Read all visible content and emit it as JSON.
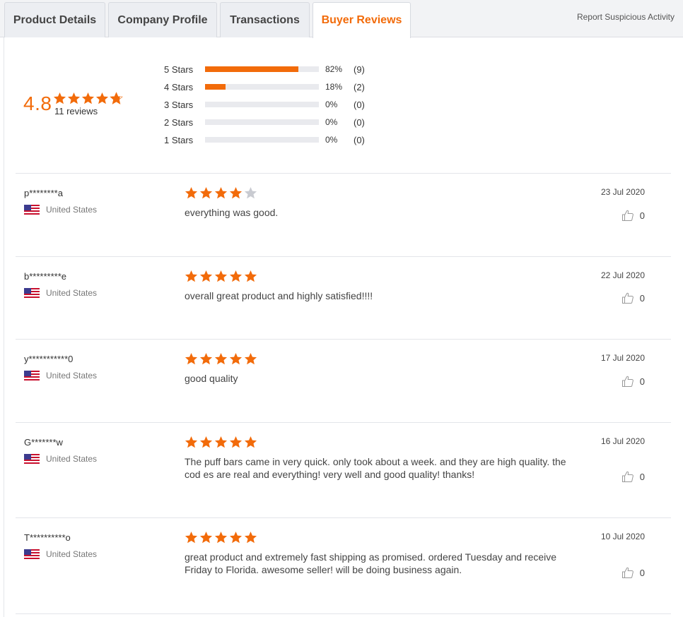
{
  "tabs": [
    {
      "label": "Product Details"
    },
    {
      "label": "Company Profile"
    },
    {
      "label": "Transactions"
    },
    {
      "label": "Buyer Reviews",
      "active": true
    }
  ],
  "report_link": "Report Suspicious Activity",
  "summary": {
    "score": "4.8",
    "stars_filled": 4.8,
    "reviews_label": "11 reviews"
  },
  "distribution": [
    {
      "label": "5 Stars",
      "percent_text": "82%",
      "percent": 82,
      "count": "(9)"
    },
    {
      "label": "4 Stars",
      "percent_text": "18%",
      "percent": 18,
      "count": "(2)"
    },
    {
      "label": "3 Stars",
      "percent_text": "0%",
      "percent": 0,
      "count": "(0)"
    },
    {
      "label": "2 Stars",
      "percent_text": "0%",
      "percent": 0,
      "count": "(0)"
    },
    {
      "label": "1 Stars",
      "percent_text": "0%",
      "percent": 0,
      "count": "(0)"
    }
  ],
  "reviews": [
    {
      "reviewer": "p********a",
      "country": "United States",
      "stars": 4,
      "comment": "everything was good.",
      "date": "23 Jul 2020",
      "likes": "0"
    },
    {
      "reviewer": "b*********e",
      "country": "United States",
      "stars": 5,
      "comment": "overall great product and highly satisfied!!!!",
      "date": "22 Jul 2020",
      "likes": "0"
    },
    {
      "reviewer": "y***********0",
      "country": "United States",
      "stars": 5,
      "comment": "good quality",
      "date": "17 Jul 2020",
      "likes": "0"
    },
    {
      "reviewer": "G*******w",
      "country": "United States",
      "stars": 5,
      "comment": "The puff bars came in very quick. only took about a week. and they are high quality. the cod es are real and everything! very well and good quality! thanks!",
      "date": "16 Jul 2020",
      "likes": "0"
    },
    {
      "reviewer": "T**********o",
      "country": "United States",
      "stars": 5,
      "comment": "great product and extremely fast shipping as promised. ordered Tuesday and receive Friday to Florida. awesome seller! will be doing business again.",
      "date": "10 Jul 2020",
      "likes": "0"
    }
  ],
  "colors": {
    "accent": "#f26b0a",
    "star_empty": "#c9cbd1"
  },
  "icons": {
    "flag": "us-flag-icon",
    "like": "thumbs-up-icon",
    "star": "star-icon"
  }
}
